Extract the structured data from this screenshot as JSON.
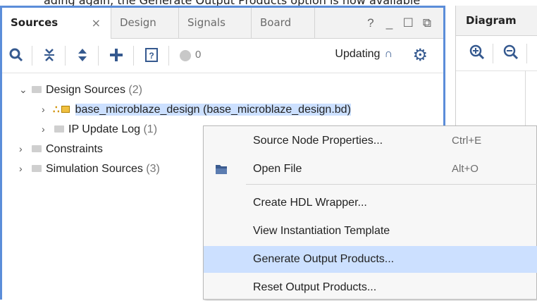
{
  "caption": "ading again, the Generate Output Products option is now available",
  "sources_panel": {
    "tabs": [
      {
        "label": "Sources",
        "active": true,
        "close": "×"
      },
      {
        "label": "Design"
      },
      {
        "label": "Signals"
      },
      {
        "label": "Board"
      }
    ],
    "window_controls": [
      "?",
      "_",
      "☐",
      "⧉"
    ],
    "toolbar": {
      "search_icon": "search-icon",
      "collapse_icon": "collapse-all-icon",
      "expand_icon": "expand-all-icon",
      "add_icon": "add-icon",
      "help_icon": "help-icon",
      "badge_count": "0",
      "status": "Updating",
      "settings_icon": "gear-icon"
    },
    "tree": [
      {
        "label": "Design Sources",
        "count": "(2)",
        "expanded": true
      },
      {
        "label": "base_microblaze_design",
        "detail": "(base_microblaze_design.bd)",
        "selected": true
      },
      {
        "label": "IP Update Log",
        "count": "(1)"
      },
      {
        "label": "Constraints",
        "count": ""
      },
      {
        "label": "Simulation Sources",
        "count": "(3)"
      }
    ]
  },
  "diagram_panel": {
    "title": "Diagram",
    "zoom_in_icon": "zoom-in-icon",
    "zoom_out_icon": "zoom-out-icon"
  },
  "context_menu": {
    "items": [
      {
        "label": "Source Node Properties...",
        "shortcut": "Ctrl+E"
      },
      {
        "label": "Open File",
        "shortcut": "Alt+O",
        "icon": "folder-open-icon"
      },
      {
        "label": "Create HDL Wrapper..."
      },
      {
        "label": "View Instantiation Template"
      },
      {
        "label": "Generate Output Products...",
        "highlighted": true
      },
      {
        "label": "Reset Output Products..."
      }
    ]
  },
  "colors": {
    "accent": "#5b8dd9",
    "selection": "#cce0ff",
    "icon": "#35598f"
  }
}
